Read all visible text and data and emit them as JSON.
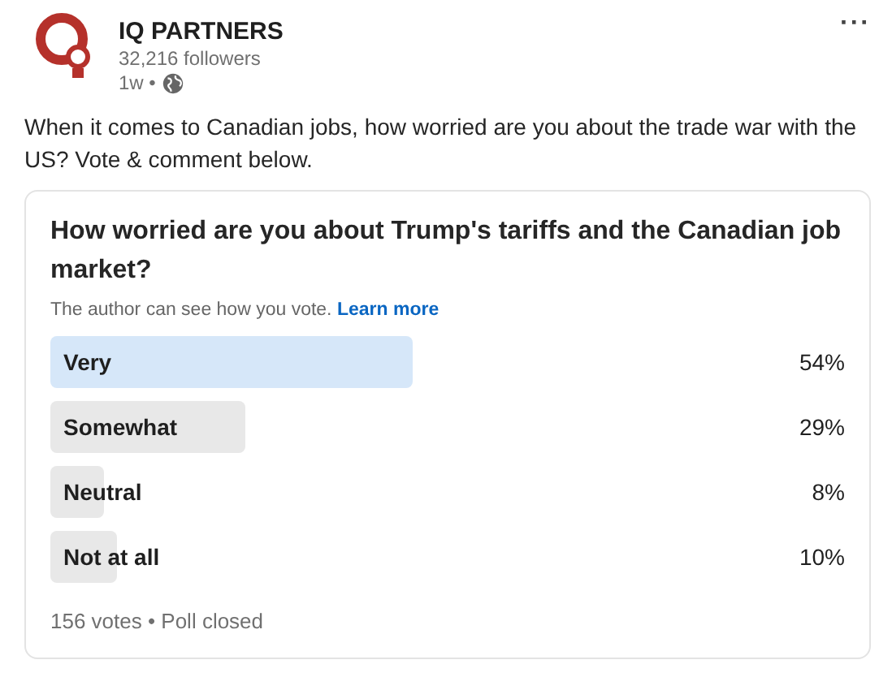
{
  "author": {
    "name": "IQ PARTNERS",
    "followers": "32,216 followers",
    "age": "1w •"
  },
  "menu": "···",
  "text": "When it comes to Canadian jobs, how worried are you about the trade war with the US? Vote & comment below.",
  "poll": {
    "question": "How worried are you about Trump's tariffs and the Canadian job market?",
    "notice": "The author can see how you vote.",
    "link": "Learn more",
    "options": [
      {
        "label": "Very",
        "percent": "54%",
        "selected": true
      },
      {
        "label": "Somewhat",
        "percent": "29%",
        "selected": false
      },
      {
        "label": "Neutral",
        "percent": "8%",
        "selected": false
      },
      {
        "label": "Not at all",
        "percent": "10%",
        "selected": false
      }
    ],
    "footer": "156 votes • Poll closed"
  }
}
